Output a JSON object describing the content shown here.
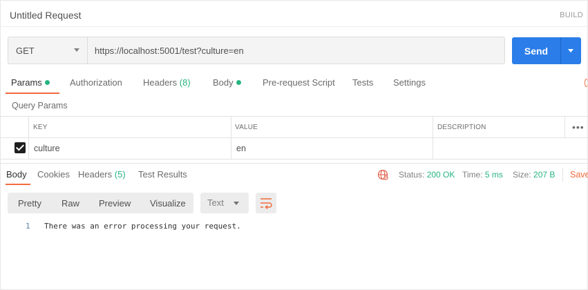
{
  "header": {
    "title": "Untitled Request",
    "build_label": "BUILD"
  },
  "request": {
    "method": "GET",
    "url": "https://localhost:5001/test?culture=en",
    "send_label": "Send"
  },
  "request_tabs": [
    {
      "label": "Params",
      "dot": true,
      "count": ""
    },
    {
      "label": "Authorization",
      "dot": false,
      "count": ""
    },
    {
      "label": "Headers",
      "dot": false,
      "count": "(8)"
    },
    {
      "label": "Body",
      "dot": true,
      "count": ""
    },
    {
      "label": "Pre-request Script",
      "dot": false,
      "count": ""
    },
    {
      "label": "Tests",
      "dot": false,
      "count": ""
    },
    {
      "label": "Settings",
      "dot": false,
      "count": ""
    }
  ],
  "query_params": {
    "title": "Query Params",
    "columns": [
      "KEY",
      "VALUE",
      "DESCRIPTION"
    ],
    "more_label": "•••",
    "rows": [
      {
        "checked": true,
        "key": "culture",
        "value": "en",
        "description": ""
      }
    ]
  },
  "response_tabs": [
    {
      "label": "Body",
      "count": ""
    },
    {
      "label": "Cookies",
      "count": ""
    },
    {
      "label": "Headers",
      "count": "(5)"
    },
    {
      "label": "Test Results",
      "count": ""
    }
  ],
  "response_meta": {
    "status_label": "Status:",
    "status_value": "200 OK",
    "time_label": "Time:",
    "time_value": "5 ms",
    "size_label": "Size:",
    "size_value": "207 B",
    "save_label": "Save"
  },
  "response_toolbar": {
    "views": [
      "Pretty",
      "Raw",
      "Preview",
      "Visualize"
    ],
    "format": "Text"
  },
  "response_body": {
    "lines": [
      {
        "number": "1",
        "text": "There was an error processing your request."
      }
    ]
  },
  "colors": {
    "accent": "#f26b3a",
    "primary": "#2b7de9",
    "success": "#26b47f"
  }
}
